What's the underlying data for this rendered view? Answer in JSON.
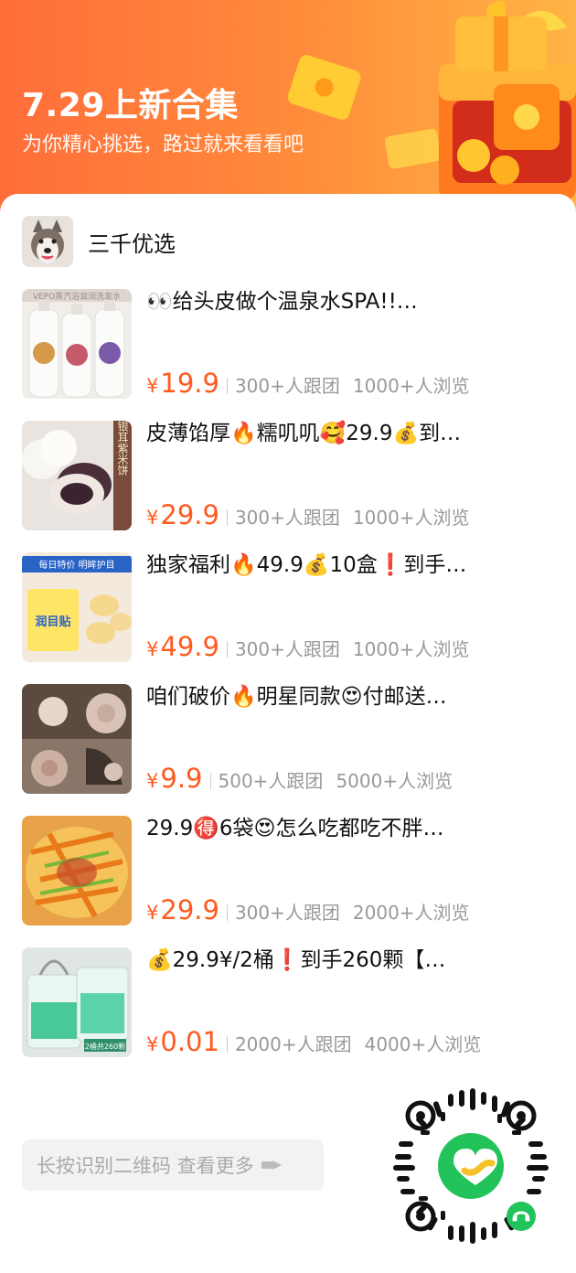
{
  "hero": {
    "title": "7.29上新合集",
    "subtitle": "为你精心挑选，路过就来看看吧"
  },
  "shop": {
    "name": "三千优选"
  },
  "products": [
    {
      "title": "👀给头皮做个温泉水SPA!!…",
      "price": "19.9",
      "group": "300+人跟团",
      "views": "1000+人浏览"
    },
    {
      "title": "皮薄馅厚🔥糯叽叽🥰29.9💰到…",
      "price": "29.9",
      "group": "300+人跟团",
      "views": "1000+人浏览"
    },
    {
      "title": "独家福利🔥49.9💰10盒❗到手…",
      "price": "49.9",
      "group": "300+人跟团",
      "views": "1000+人浏览"
    },
    {
      "title": "咱们破价🔥明星同款😍付邮送…",
      "price": "9.9",
      "group": "500+人跟团",
      "views": "5000+人浏览"
    },
    {
      "title": "29.9🉐6袋😍怎么吃都吃不胖…",
      "price": "29.9",
      "group": "300+人跟团",
      "views": "2000+人浏览"
    },
    {
      "title": "💰29.9¥/2桶❗到手260颗【…",
      "price": "0.01",
      "group": "2000+人跟团",
      "views": "4000+人浏览"
    }
  ],
  "currency": "¥",
  "thumb_text": {
    "shampoo": "VEPO蒸汽浴滋润洗发水",
    "cake": "山药银耳紫米饼",
    "patch_banner": "每日特价 明眸护目",
    "patch_box": "润目贴",
    "cube": "2桶共260颗"
  },
  "footer": {
    "more_label": "长按识别二维码 查看更多"
  },
  "colors": {
    "accent": "#ff5a1f",
    "hero_start": "#ff6e3a",
    "hero_end": "#ffb445",
    "qr_green": "#21c35a"
  }
}
